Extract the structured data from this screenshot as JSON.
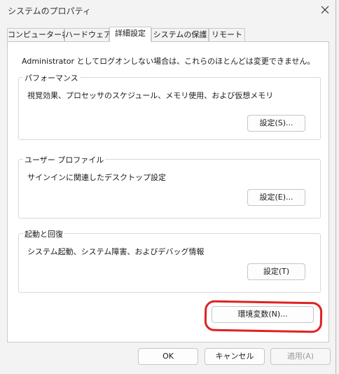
{
  "window": {
    "title": "システムのプロパティ"
  },
  "tabs": [
    {
      "label": "コンピューター名"
    },
    {
      "label": "ハードウェア"
    },
    {
      "label": "詳細設定"
    },
    {
      "label": "システムの保護"
    },
    {
      "label": "リモート"
    }
  ],
  "panel": {
    "notice": "Administrator としてログオンしない場合は、これらのほとんどは変更できません。",
    "performance": {
      "label": "パフォーマンス",
      "description": "視覚効果、プロセッサのスケジュール、メモリ使用、および仮想メモリ",
      "button": "設定(S)..."
    },
    "user_profile": {
      "label": "ユーザー プロファイル",
      "description": "サインインに関連したデスクトップ設定",
      "button": "設定(E)..."
    },
    "startup": {
      "label": "起動と回復",
      "description": "システム起動、システム障害、およびデバッグ情報",
      "button": "設定(T)"
    },
    "env_button": "環境変数(N)..."
  },
  "footer": {
    "ok": "OK",
    "cancel": "キャンセル",
    "apply": "適用(A)"
  },
  "colors": {
    "highlight": "#e02121"
  }
}
